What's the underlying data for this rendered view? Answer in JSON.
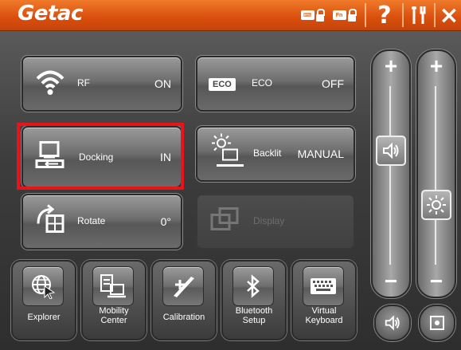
{
  "titlebar": {
    "logo": "Getac",
    "help_glyph": "?",
    "close_glyph": "×",
    "color": "#d9500e"
  },
  "tiles": {
    "rf": {
      "label": "RF",
      "value": "ON"
    },
    "eco": {
      "icon_text": "ECO",
      "label": "ECO",
      "value": "OFF"
    },
    "docking": {
      "label": "Docking",
      "value": "IN"
    },
    "backlit": {
      "label": "Backlit",
      "value": "MANUAL"
    },
    "rotate": {
      "label": "Rotate",
      "value": "0°"
    },
    "display": {
      "label": "Display"
    }
  },
  "apps": [
    {
      "label_line1": "Explorer",
      "label_line2": ""
    },
    {
      "label_line1": "Mobility",
      "label_line2": "Center"
    },
    {
      "label_line1": "Calibration",
      "label_line2": ""
    },
    {
      "label_line1": "Bluetooth",
      "label_line2": "Setup"
    },
    {
      "label_line1": "Virtual",
      "label_line2": "Keyboard"
    }
  ],
  "sliders": {
    "plus": "+",
    "minus": "−"
  },
  "colors": {
    "highlight": "#e8141c"
  }
}
